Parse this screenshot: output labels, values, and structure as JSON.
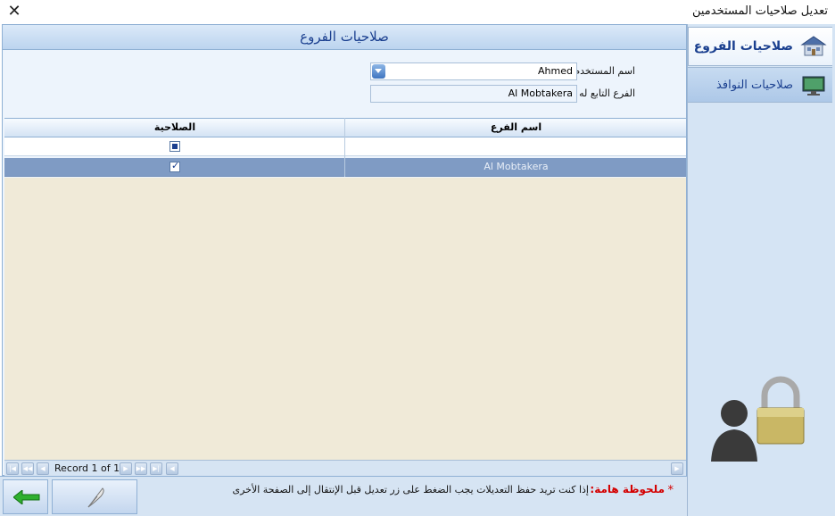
{
  "window": {
    "title": "تعديل صلاحيات المستخدمين",
    "close_label": "✕"
  },
  "nav": {
    "items": [
      {
        "label": "صلاحيات الفروع",
        "icon": "house-icon",
        "active": true
      },
      {
        "label": "صلاحيات النوافذ",
        "icon": "monitor-icon",
        "active": false
      }
    ]
  },
  "panel": {
    "title": "صلاحيات الفروع"
  },
  "form": {
    "user_label": "اسم المستخدم",
    "user_value": "Ahmed",
    "branch_label": "الفرع التابع له",
    "branch_value": "Al Mobtakera"
  },
  "grid": {
    "columns": [
      "الصلاحية",
      "اسم الفرع"
    ],
    "rows": [
      {
        "branch": "Al Mobtakera",
        "permission": true
      }
    ]
  },
  "navigator": {
    "record_text": "Record 1 of 1"
  },
  "note": {
    "star": "*",
    "title": "ملحوظة هامة:",
    "text": "إذا كنت تريد حفظ التعديلات يجب الضغط على زر تعديل قبل الإنتقال إلى الصفحة الأخرى"
  },
  "colors": {
    "accent": "#1a3f8f",
    "selected_row": "#7f9bc4",
    "warning": "#d40000"
  }
}
